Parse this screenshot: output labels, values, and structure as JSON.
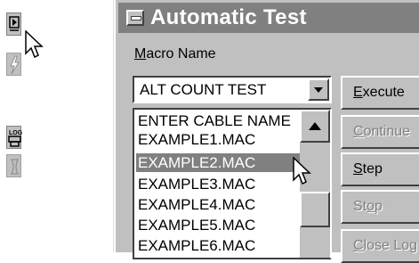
{
  "window": {
    "title": "Automatic Test"
  },
  "macro": {
    "label_prefix": "M",
    "label_rest": "acro Name",
    "selected": "ALT COUNT TEST"
  },
  "list": {
    "items": [
      "ENTER CABLE NAME",
      "EXAMPLE1.MAC",
      "EXAMPLE2.MAC",
      "EXAMPLE3.MAC",
      "EXAMPLE4.MAC",
      "EXAMPLE5.MAC",
      "EXAMPLE6.MAC"
    ],
    "selected_index": 2
  },
  "buttons": {
    "execute": {
      "hot": "E",
      "rest": "xecute"
    },
    "continue": {
      "hot": "C",
      "rest": "ontinue"
    },
    "step": {
      "hot": "S",
      "rest": "tep"
    },
    "stop": {
      "hot": "o",
      "pre": "St",
      "rest": "p"
    },
    "close": {
      "hot": "C",
      "rest": "lose Log"
    }
  },
  "toolbar": {
    "icons": [
      "run-script-icon",
      "lightning-icon",
      "log-printer-icon",
      "spool-icon"
    ]
  },
  "colors": {
    "face": "#c0c0c0",
    "title_bar": "#808080",
    "selection": "#808080"
  }
}
